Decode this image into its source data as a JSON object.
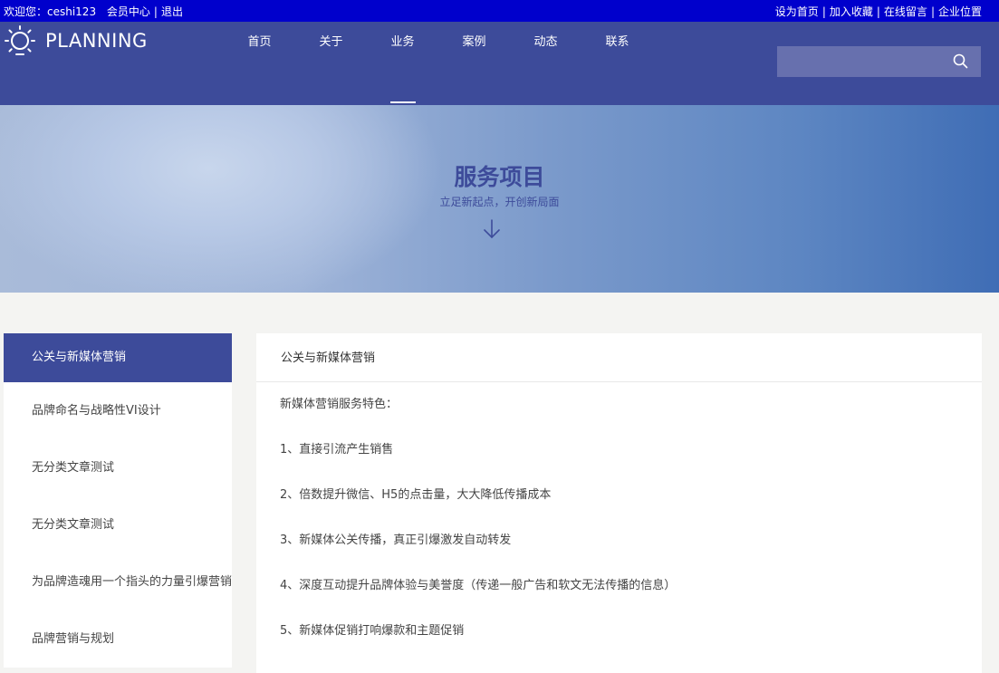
{
  "topbar": {
    "welcome": "欢迎您：ceshi123",
    "member_center": "会员中心",
    "sep": "|",
    "logout": "退出",
    "set_home": "设为首页",
    "add_fav": "加入收藏",
    "message": "在线留言",
    "location": "企业位置"
  },
  "header": {
    "logo_text": "PLANNING",
    "nav": [
      "首页",
      "关于",
      "业务",
      "案例",
      "动态",
      "联系"
    ],
    "active_nav": "业务",
    "search_placeholder": ""
  },
  "banner": {
    "title": "服务项目",
    "subtitle": "立足新起点，开创新局面"
  },
  "sidebar": {
    "items": [
      "公关与新媒体营销",
      "品牌命名与战略性VI设计",
      "无分类文章测试",
      "无分类文章测试",
      "为品牌造魂用一个指头的力量引爆营销",
      "品牌营销与规划"
    ]
  },
  "content": {
    "heading": "公关与新媒体营销",
    "lines": [
      "新媒体营销服务特色：",
      "1、直接引流产生销售",
      "2、倍数提升微信、H5的点击量，大大降低传播成本",
      "3、新媒体公关传播，真正引爆激发自动转发",
      "4、深度互动提升品牌体验与美誉度（传递一般广告和软文无法传播的信息）",
      "5、新媒体促销打响爆款和主题促销"
    ]
  },
  "colors": {
    "topbar": "#0000cc",
    "header": "#3d4b9a",
    "accent": "#3d4b9a"
  }
}
